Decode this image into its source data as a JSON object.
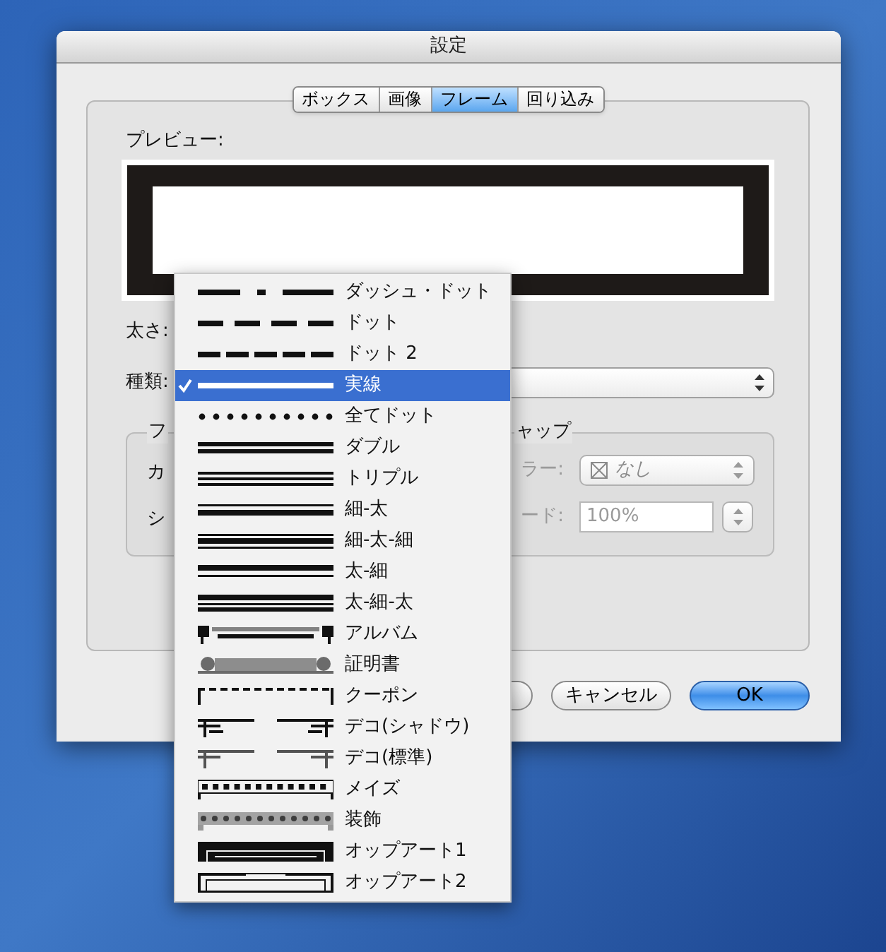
{
  "window": {
    "title": "設定"
  },
  "tabs": [
    {
      "label": "ボックス",
      "selected": false
    },
    {
      "label": "画像",
      "selected": false
    },
    {
      "label": "フレーム",
      "selected": true
    },
    {
      "label": "回り込み",
      "selected": false
    }
  ],
  "preview": {
    "label": "プレビュー:"
  },
  "thickness": {
    "label": "太さ:"
  },
  "style": {
    "label": "種類:"
  },
  "left_group": {
    "title": "フ",
    "rows": [
      "カ",
      "シ"
    ]
  },
  "right_group": {
    "title": "ャップ",
    "color": {
      "label": "ラー:",
      "value": "なし",
      "disabled": true
    },
    "shade": {
      "label": "ード:",
      "value": "100%",
      "disabled": true
    }
  },
  "buttons": [
    {
      "label": "キャンセル",
      "default": false
    },
    {
      "label": "OK",
      "default": true
    }
  ],
  "style_menu": {
    "items": [
      {
        "label": "ダッシュ・ドット",
        "kind": "dash-dot",
        "selected": false
      },
      {
        "label": "ドット",
        "kind": "dash",
        "selected": false
      },
      {
        "label": "ドット 2",
        "kind": "dash-short",
        "selected": false
      },
      {
        "label": "実線",
        "kind": "solid",
        "selected": true
      },
      {
        "label": "全てドット",
        "kind": "dots",
        "selected": false
      },
      {
        "label": "ダブル",
        "kind": "double",
        "selected": false
      },
      {
        "label": "トリプル",
        "kind": "triple",
        "selected": false
      },
      {
        "label": "細-太",
        "kind": "thin-thick",
        "selected": false
      },
      {
        "label": "細-太-細",
        "kind": "thin-thick-thin",
        "selected": false
      },
      {
        "label": "太-細",
        "kind": "thick-thin",
        "selected": false
      },
      {
        "label": "太-細-太",
        "kind": "thick-thin-thick",
        "selected": false
      },
      {
        "label": "アルバム",
        "kind": "album",
        "selected": false
      },
      {
        "label": "証明書",
        "kind": "certificate",
        "selected": false
      },
      {
        "label": "クーポン",
        "kind": "coupon",
        "selected": false
      },
      {
        "label": "デコ(シャドウ)",
        "kind": "deco-shadow",
        "selected": false
      },
      {
        "label": "デコ(標準)",
        "kind": "deco-standard",
        "selected": false
      },
      {
        "label": "メイズ",
        "kind": "maze",
        "selected": false
      },
      {
        "label": "装飾",
        "kind": "ornament",
        "selected": false
      },
      {
        "label": "オップアート1",
        "kind": "opart1",
        "selected": false
      },
      {
        "label": "オップアート2",
        "kind": "opart2",
        "selected": false
      }
    ]
  }
}
